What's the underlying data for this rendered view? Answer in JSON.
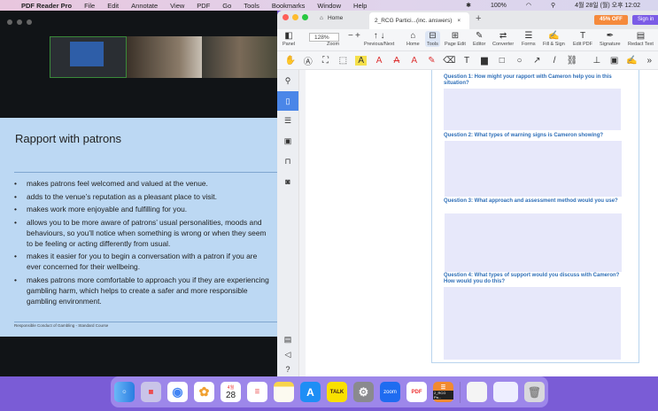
{
  "menubar": {
    "app": "PDF Reader Pro",
    "items": [
      "File",
      "Edit",
      "Annotate",
      "View",
      "PDF",
      "Go",
      "Tools",
      "Bookmarks",
      "Window",
      "Help"
    ],
    "battery": "100%",
    "clock": "4월 28일 (월) 오후 12:02"
  },
  "slide": {
    "title": "Rapport with patrons",
    "bullets": [
      "makes patrons feel welcomed and valued at the venue.",
      "adds to the venue’s reputation as a pleasant place to visit.",
      "makes work more enjoyable and fulfilling for you.",
      "allows you to be more aware of patrons’ usual personalities, moods and",
      "behaviours, so you’ll notice when something is wrong or when they seem",
      "to be feeling or acting differently from usual.",
      "makes it easier for you to begin a conversation with a patron if you are",
      "ever concerned for their wellbeing.",
      "makes patrons more comfortable to approach you if they are experiencing",
      "gambling harm, which helps to create a safer and more responsible",
      "gambling environment."
    ],
    "footer": "Responsible Conduct of Gambling - Standard Course"
  },
  "pdf": {
    "tabs": {
      "home": "Home",
      "doc": "2_RCG Partici...(inc. answers)",
      "close": "×",
      "add": "+"
    },
    "promo": "45% OFF",
    "sign_in": "Sign in",
    "toolbar": {
      "panel": "Panel",
      "zoom_value": "128%",
      "zoom": "Zoom",
      "prevnext": "Previous/Next",
      "home": "Home",
      "tools": "Tools",
      "page_edit": "Page Edit",
      "editor": "Editor",
      "converter": "Converter",
      "forms": "Forms",
      "fill_sign": "Fill & Sign",
      "edit_pdf": "Edit PDF",
      "signature": "Signature",
      "redact": "Redact Text"
    },
    "questions": [
      "Question 1: How might your rapport with Cameron help you in this situation?",
      "Question 2: What types of warning signs is Cameron showing?",
      "Question 3: What approach and assessment method would you use?",
      "Question 4: What types of support would you discuss with Cameron? How would you do this?"
    ]
  },
  "dock": {
    "calendar_month": "4월",
    "calendar_day": "28",
    "talk": "TALK",
    "zoom": "zoom",
    "pdf": "PDF",
    "file_label": "2_RCG Pa..."
  }
}
